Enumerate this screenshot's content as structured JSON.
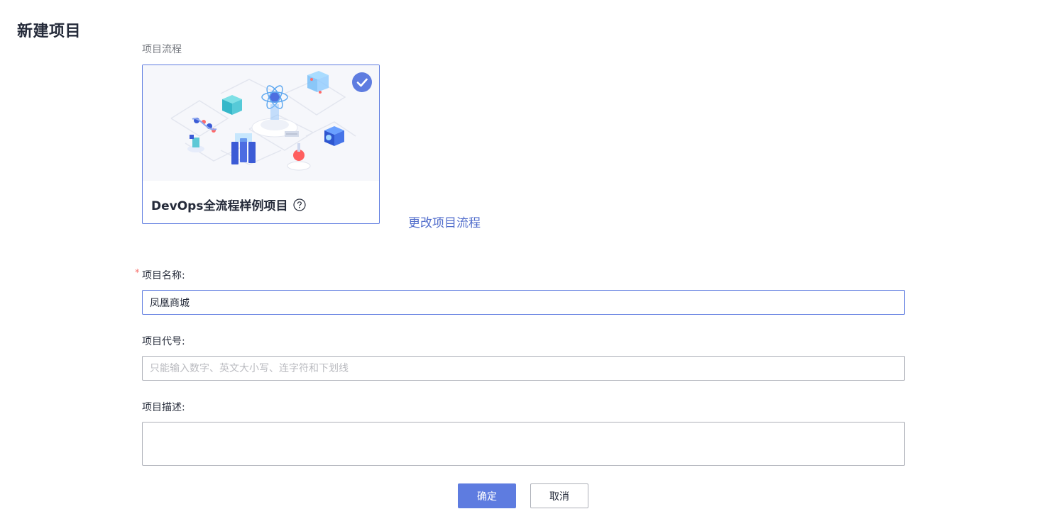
{
  "page": {
    "title": "新建项目"
  },
  "process": {
    "label": "项目流程",
    "selected_template": {
      "title": "DevOps全流程样例项目",
      "selected": true
    },
    "change_link": "更改项目流程"
  },
  "form": {
    "name": {
      "label": "项目名称:",
      "required_mark": "*",
      "value": "凤凰商城"
    },
    "code": {
      "label": "项目代号:",
      "placeholder": "只能输入数字、英文大小写、连字符和下划线",
      "value": ""
    },
    "description": {
      "label": "项目描述:",
      "value": ""
    }
  },
  "actions": {
    "confirm_label": "确定",
    "cancel_label": "取消"
  },
  "colors": {
    "accent": "#5e7ce0",
    "link": "#526ecc",
    "required": "#f66f6a"
  },
  "icons": {
    "check": "check-circle-icon",
    "help": "question-circle-icon"
  }
}
